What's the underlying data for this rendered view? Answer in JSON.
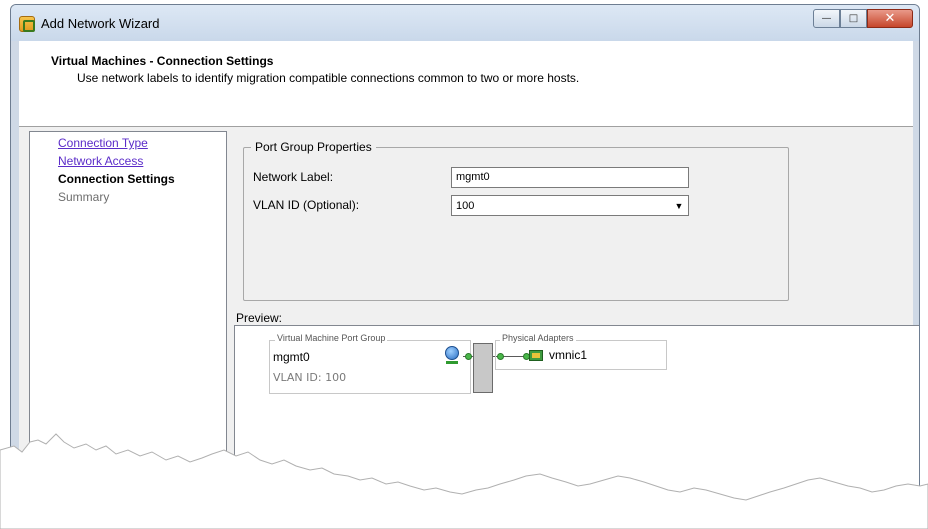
{
  "window": {
    "title": "Add Network Wizard",
    "controls": {
      "minimize": "—",
      "maximize": "□",
      "close": "✕"
    }
  },
  "header": {
    "title": "Virtual Machines - Connection Settings",
    "description": "Use network labels to identify migration compatible connections common to two or more hosts."
  },
  "nav": {
    "items": [
      {
        "label": "Connection Type",
        "state": "link"
      },
      {
        "label": "Network Access",
        "state": "link"
      },
      {
        "label": "Connection Settings",
        "state": "current"
      },
      {
        "label": "Summary",
        "state": "future"
      }
    ]
  },
  "port_group": {
    "legend": "Port Group Properties",
    "network_label": {
      "label": "Network Label:",
      "value": "mgmt0"
    },
    "vlan_id": {
      "label": "VLAN ID (Optional):",
      "value": "100"
    }
  },
  "preview": {
    "label": "Preview:",
    "vm_port_group": {
      "legend": "Virtual Machine Port Group",
      "name": "mgmt0",
      "vlan": "VLAN ID: 100"
    },
    "physical_adapters": {
      "legend": "Physical Adapters",
      "adapter": "vmnic1"
    }
  },
  "colors": {
    "link": "#5b2cc9",
    "frame": "#cfd9e6",
    "dot": "#49b649"
  }
}
